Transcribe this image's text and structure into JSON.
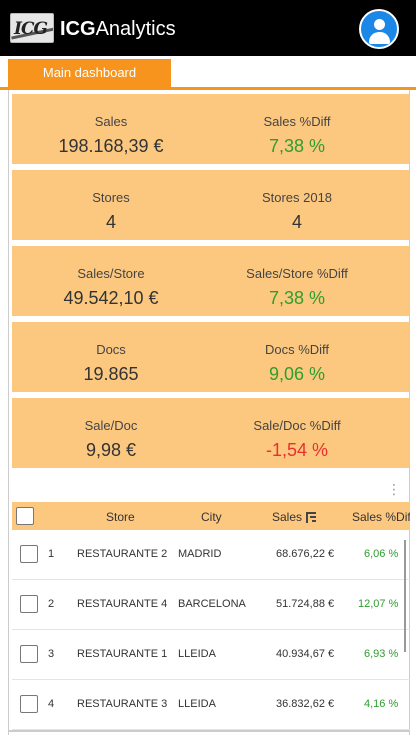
{
  "app": {
    "logo_text": "ICG",
    "brand_bold": "ICG",
    "brand_rest": "Analytics"
  },
  "tabs": [
    {
      "label": "Main dashboard"
    }
  ],
  "cards": [
    {
      "left_label": "Sales",
      "left_value": "198.168,39 €",
      "right_label": "Sales %Diff",
      "right_value": "7,38 %",
      "right_status": "pos"
    },
    {
      "left_label": "Stores",
      "left_value": "4",
      "right_label": "Stores 2018",
      "right_value": "4",
      "right_status": "neutral"
    },
    {
      "left_label": "Sales/Store",
      "left_value": "49.542,10 €",
      "right_label": "Sales/Store %Diff",
      "right_value": "7,38 %",
      "right_status": "pos"
    },
    {
      "left_label": "Docs",
      "left_value": "19.865",
      "right_label": "Docs %Diff",
      "right_value": "9,06 %",
      "right_status": "pos"
    },
    {
      "left_label": "Sale/Doc",
      "left_value": "9,98 €",
      "right_label": "Sale/Doc %Diff",
      "right_value": "-1,54 %",
      "right_status": "neg"
    }
  ],
  "table": {
    "menu_icon": "more-vertical-icon",
    "columns": [
      "Store",
      "City",
      "Sales",
      "Sales %Diff"
    ],
    "sort_icon": "sort-descending-icon",
    "rows": [
      {
        "index": "1",
        "store": "RESTAURANTE 2",
        "city": "MADRID",
        "sales": "68.676,22 €",
        "diff": "6,06 %"
      },
      {
        "index": "2",
        "store": "RESTAURANTE 4",
        "city": "BARCELONA",
        "sales": "51.724,88 €",
        "diff": "12,07 %"
      },
      {
        "index": "3",
        "store": "RESTAURANTE 1",
        "city": "LLEIDA",
        "sales": "40.934,67 €",
        "diff": "6,93 %"
      },
      {
        "index": "4",
        "store": "RESTAURANTE 3",
        "city": "LLEIDA",
        "sales": "36.832,62 €",
        "diff": "4,16 %"
      }
    ]
  },
  "colors": {
    "accent": "#f7941d",
    "card_bg": "#fcc880",
    "positive": "#2e9e2e",
    "negative": "#e83030",
    "avatar": "#1b87e6"
  }
}
